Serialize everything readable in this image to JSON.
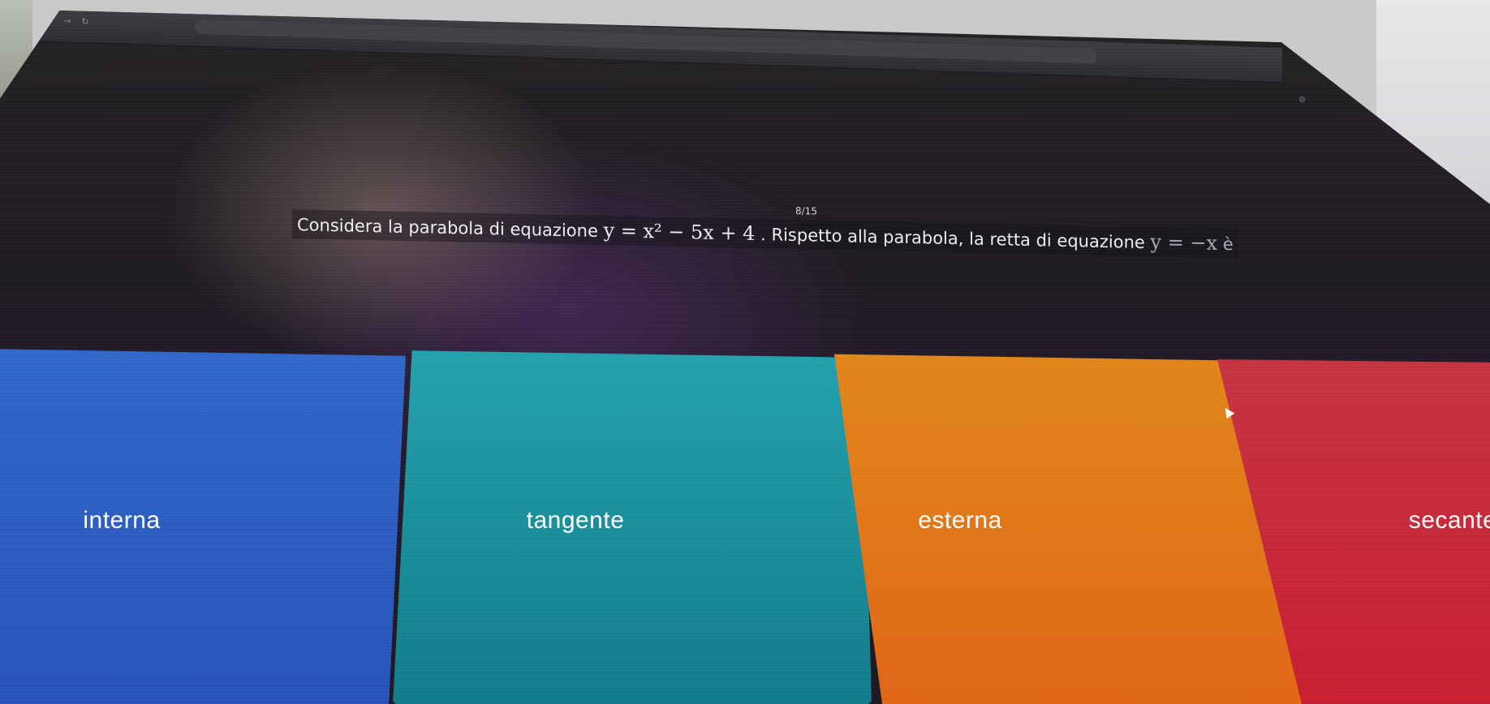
{
  "browser": {
    "back_icon": "arrow-left-icon",
    "forward_icon": "arrow-right-icon",
    "reload_icon": "reload-icon",
    "url": ""
  },
  "quiz": {
    "counter": "8/15",
    "question_prefix": "Considera la parabola di equazione",
    "equation_parabola": "y = x² − 5x + 4",
    "question_middle": ". Rispetto alla parabola, la retta di equazione",
    "equation_line": "y = −x",
    "question_suffix": "è"
  },
  "answers": [
    {
      "label": "interna",
      "color": "#2c5fc4"
    },
    {
      "label": "tangente",
      "color": "#1a8e9c"
    },
    {
      "label": "esterna",
      "color": "#e07418"
    },
    {
      "label": "secante",
      "color": "#c82637"
    }
  ]
}
